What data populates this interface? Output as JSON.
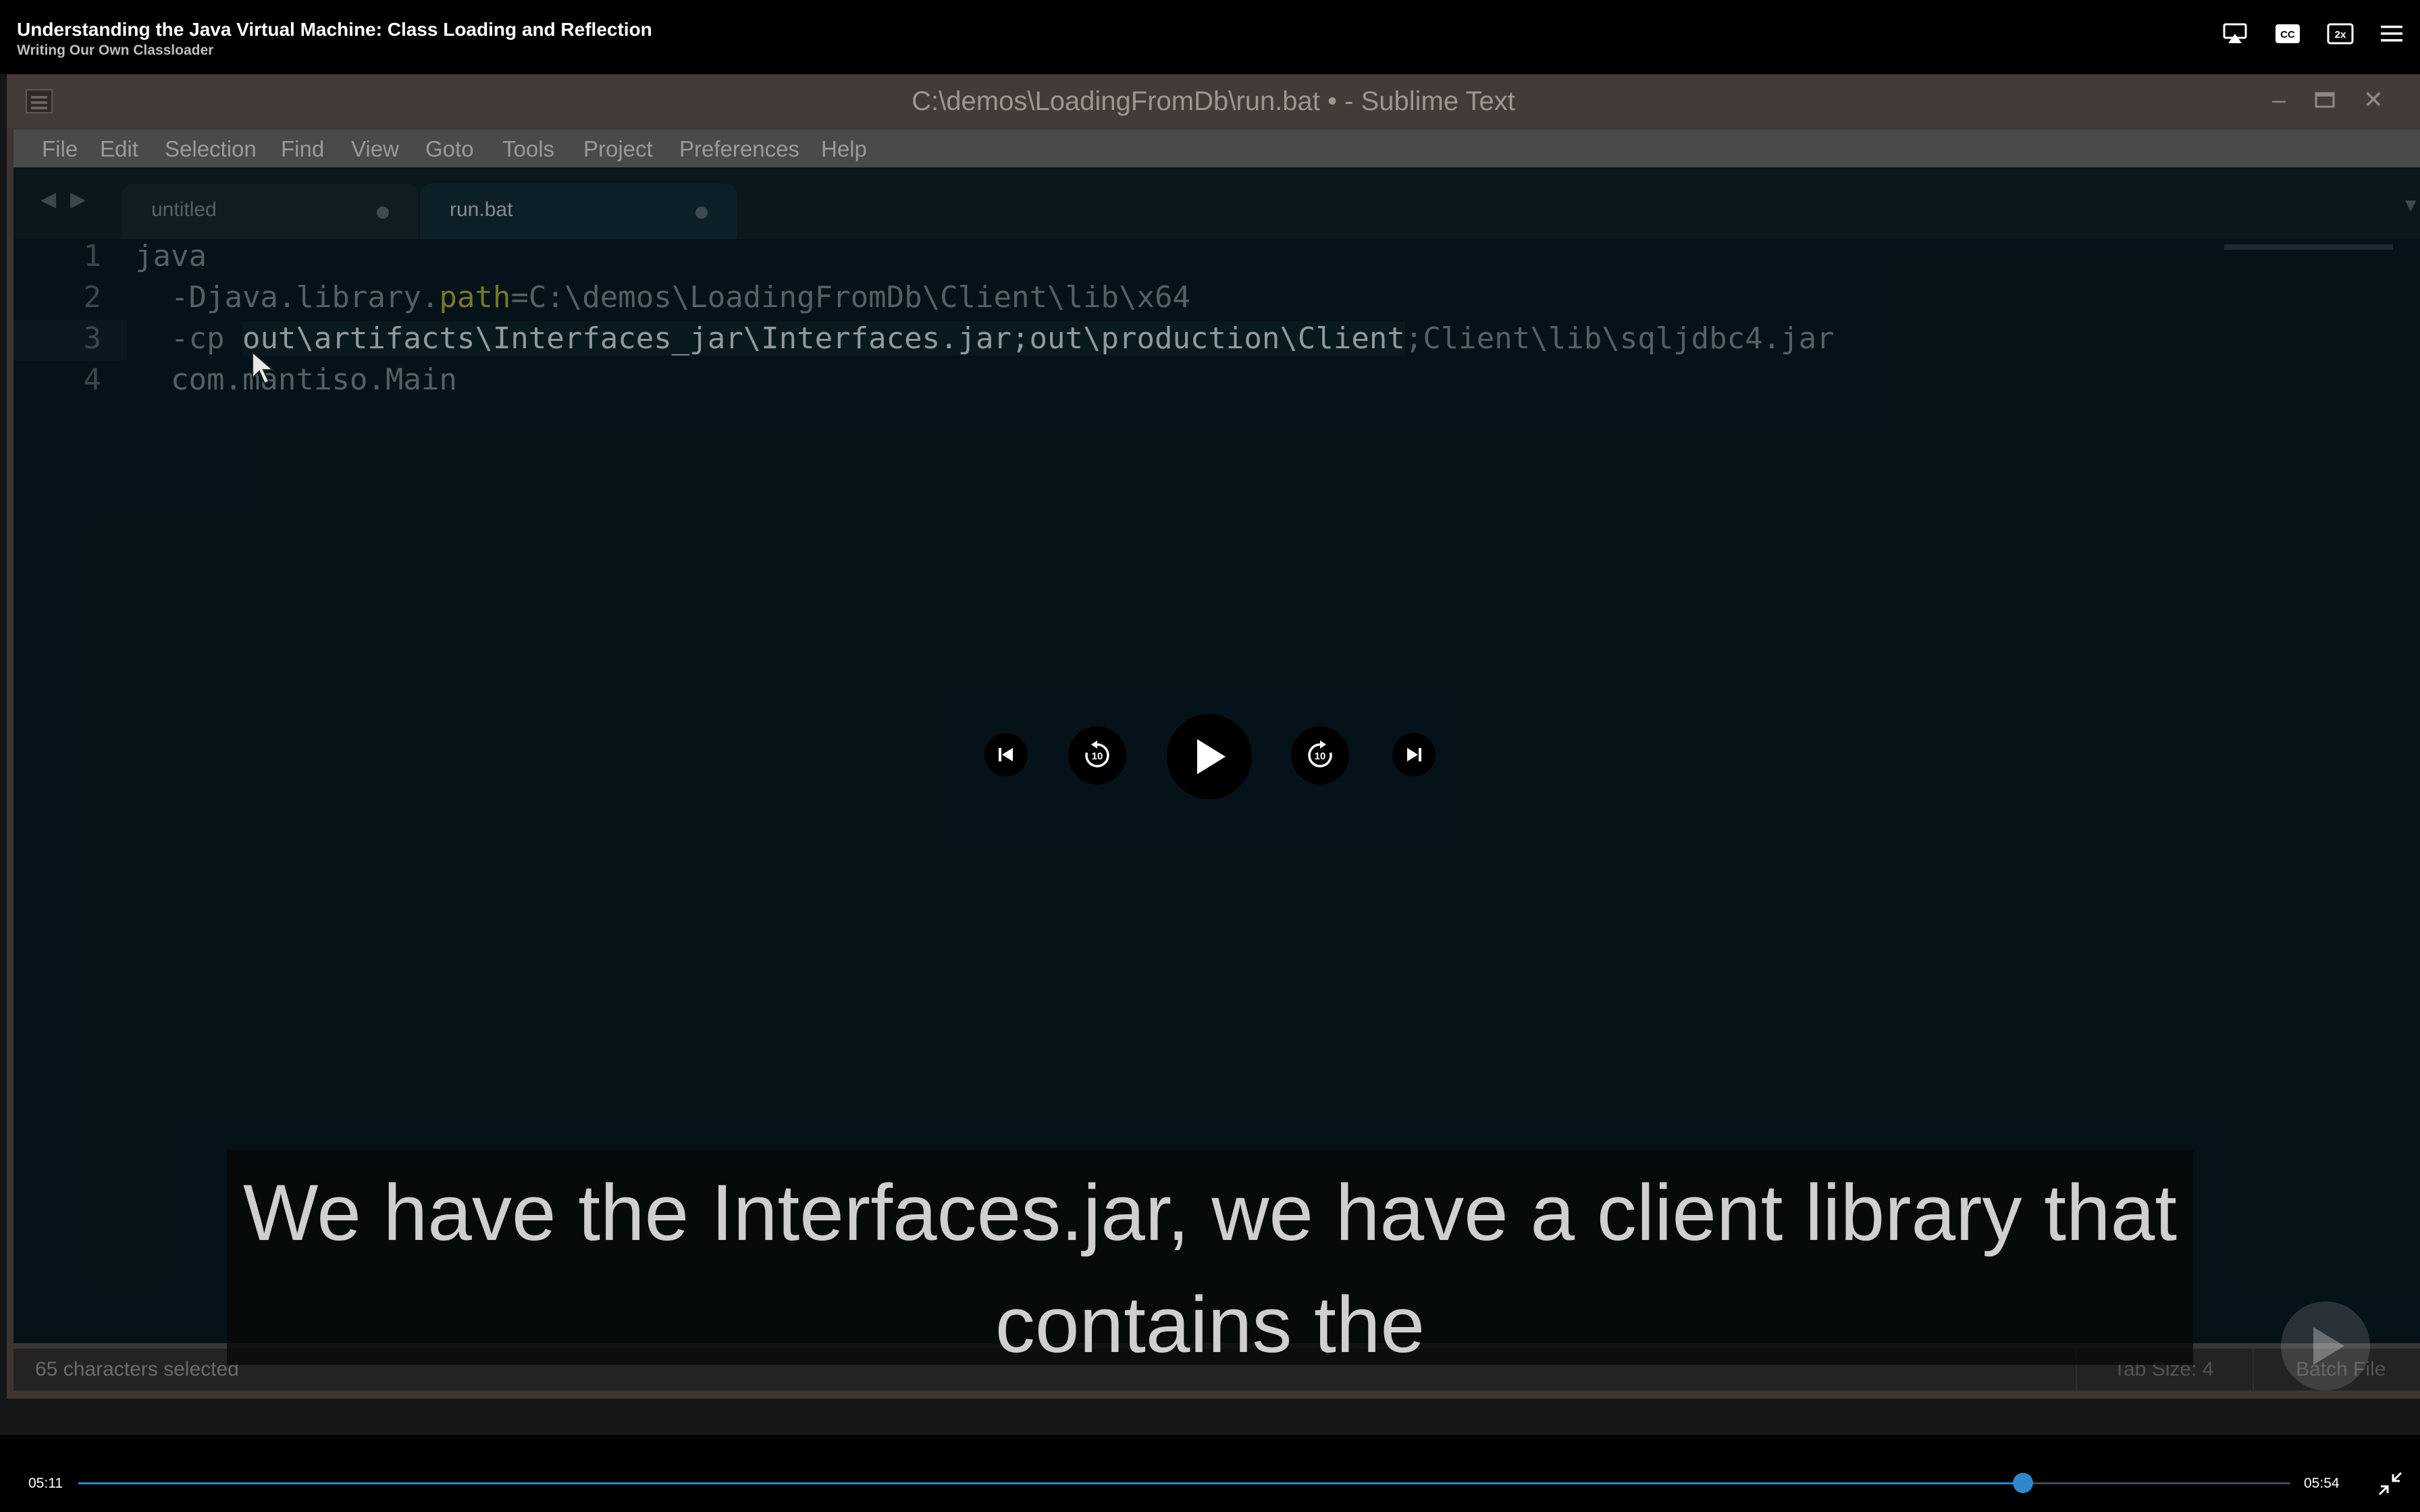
{
  "header": {
    "course_title": "Understanding the Java Virtual Machine: Class Loading and Reflection",
    "module_title": "Writing Our Own Classloader",
    "icons": [
      "airplay-icon",
      "closed-captions-icon",
      "playback-speed-icon",
      "menu-icon"
    ],
    "speed_label": "2x",
    "cc_label": "CC"
  },
  "editor": {
    "window_title": "C:\\demos\\LoadingFromDb\\run.bat • - Sublime Text",
    "menu": [
      "File",
      "Edit",
      "Selection",
      "Find",
      "View",
      "Goto",
      "Tools",
      "Project",
      "Preferences",
      "Help"
    ],
    "tabs": [
      {
        "label": "untitled",
        "modified": true
      },
      {
        "label": "run.bat",
        "modified": true,
        "active": true
      }
    ],
    "line_numbers": [
      "1",
      "2",
      "3",
      "4"
    ],
    "code": {
      "l1": "java",
      "l2a": "  -Djava.library.",
      "l2b": "path",
      "l2c": "=C:\\demos\\LoadingFromDb\\Client\\lib\\x64",
      "l3a": "  -cp ",
      "l3b": "out\\artifacts\\Interfaces_jar\\Interfaces.jar;out\\production\\Client",
      "l3c": ";Client\\lib\\sqljdbc4.jar",
      "l4": "  com.mantiso.Main"
    },
    "status": {
      "selection": "65 characters selected",
      "tab_size": "Tab Size: 4",
      "syntax": "Batch File"
    }
  },
  "caption": {
    "line1": "We have the Interfaces.jar, we have a client library that",
    "line2": "contains the"
  },
  "controls": {
    "rewind_seconds": "10",
    "forward_seconds": "10"
  },
  "playback": {
    "current_time": "05:11",
    "total_time": "05:54",
    "progress_fraction": 0.879,
    "accent_color": "#2f86c9"
  }
}
